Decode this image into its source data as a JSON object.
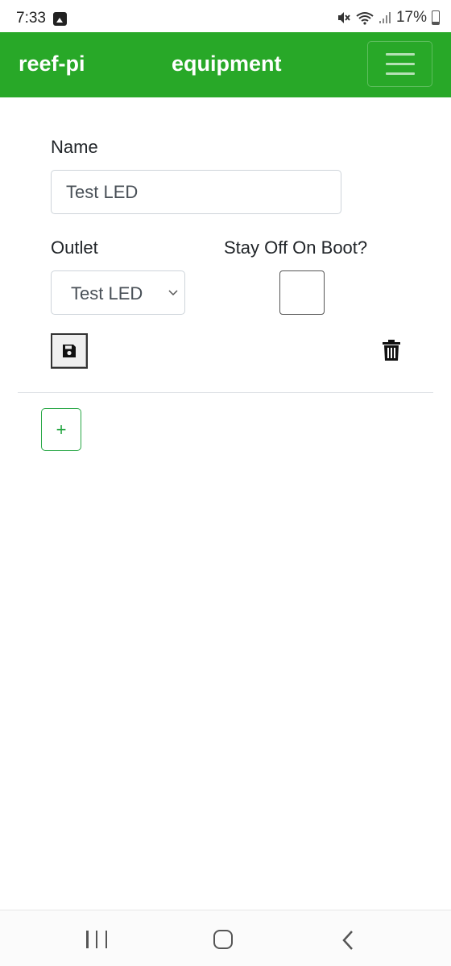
{
  "status_bar": {
    "time": "7:33",
    "battery": "17%",
    "icons": [
      "image-icon",
      "mute-icon",
      "wifi-icon",
      "signal-icon",
      "battery-icon"
    ]
  },
  "navbar": {
    "brand": "reef-pi",
    "title": "equipment",
    "menu_icon": "hamburger-icon",
    "color": "#28a828"
  },
  "form": {
    "name_label": "Name",
    "name_value": "Test LED",
    "outlet_label": "Outlet",
    "outlet_selected": "Test LED",
    "stay_off_label": "Stay Off On Boot?",
    "stay_off_checked": false,
    "save_icon": "save-icon",
    "delete_icon": "trash-icon"
  },
  "add_button": {
    "label": "+",
    "color": "#28a745"
  },
  "system_nav": {
    "icons": [
      "recents-icon",
      "home-icon",
      "back-icon"
    ]
  }
}
